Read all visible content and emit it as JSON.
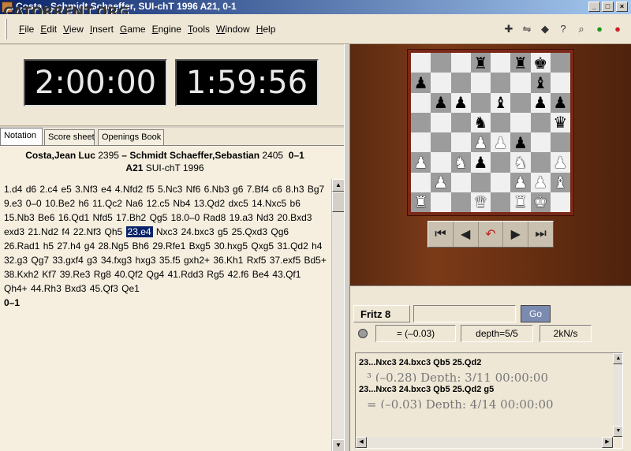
{
  "window": {
    "title": "Costa - Schmidt Schaeffer, SUI-chT 1996  A21, 0-1",
    "watermark": "CATORRENT.ORG",
    "buttons": {
      "minimize": "_",
      "maximize": "□",
      "close": "×"
    }
  },
  "menu": [
    "File",
    "Edit",
    "View",
    "Insert",
    "Game",
    "Engine",
    "Tools",
    "Window",
    "Help"
  ],
  "toolbar": [
    {
      "name": "new-game-icon",
      "glyph": "✚"
    },
    {
      "name": "flip-board-icon",
      "glyph": "⇋"
    },
    {
      "name": "hint-icon",
      "glyph": "◆"
    },
    {
      "name": "help-query-icon",
      "glyph": "?"
    },
    {
      "name": "analysis-icon",
      "glyph": "⌕"
    },
    {
      "name": "ok-icon",
      "glyph": "●"
    },
    {
      "name": "stop-icon",
      "glyph": "●"
    }
  ],
  "clocks": {
    "white": "2:00:00",
    "black": "1:59:56"
  },
  "tabs": {
    "notation": "Notation",
    "score_sheet": "Score sheet",
    "openings_book": "Openings Book"
  },
  "game": {
    "white": "Costa,Jean Luc",
    "white_elo": "2395",
    "separator": "–",
    "black": "Schmidt Schaeffer,Sebastian",
    "black_elo": "2405",
    "result": "0–1",
    "eco": "A21",
    "event": "SUI-chT 1996",
    "moves": [
      "1.d4",
      "d6",
      "2.c4",
      "e5",
      "3.Nf3",
      "e4",
      "4.Nfd2",
      "f5",
      "5.Nc3",
      "Nf6",
      "6.Nb3",
      "g6",
      "7.Bf4",
      "c6",
      "8.h3",
      "Bg7",
      "9.e3",
      "0–0",
      "10.Be2",
      "h6",
      "11.Qc2",
      "Na6",
      "12.c5",
      "Nb4",
      "13.Qd2",
      "dxc5",
      "14.Nxc5",
      "b6",
      "15.Nb3",
      "Be6",
      "16.Qd1",
      "Nfd5",
      "17.Bh2",
      "Qg5",
      "18.0–0",
      "Rad8",
      "19.a3",
      "Nd3",
      "20.Bxd3",
      "exd3",
      "21.Nd2",
      "f4",
      "22.Nf3",
      "Qh5",
      "23.e4",
      "Nxc3",
      "24.bxc3",
      "g5",
      "25.Qxd3",
      "Qg6",
      "26.Rad1",
      "h5",
      "27.h4",
      "g4",
      "28.Ng5",
      "Bh6",
      "29.Rfe1",
      "Bxg5",
      "30.hxg5",
      "Qxg5",
      "31.Qd2",
      "h4",
      "32.g3",
      "Qg7",
      "33.gxf4",
      "g3",
      "34.fxg3",
      "hxg3",
      "35.f5",
      "gxh2+",
      "36.Kh1",
      "Rxf5",
      "37.exf5",
      "Bd5+",
      "38.Kxh2",
      "Kf7",
      "39.Re3",
      "Rg8",
      "40.Qf2",
      "Qg4",
      "41.Rdd3",
      "Rg5",
      "42.f6",
      "Be4",
      "43.Qf1",
      "Qh4+",
      "44.Rh3",
      "Bxd3",
      "45.Qf3",
      "Qe1"
    ],
    "current_move": "23.e4",
    "final_result": "0–1"
  },
  "board": [
    [
      "",
      "",
      "",
      "bR",
      "",
      "bR",
      "bK",
      ""
    ],
    [
      "bP",
      "",
      "",
      "",
      "",
      "",
      "bB",
      ""
    ],
    [
      "",
      "bP",
      "bP",
      "",
      "bB",
      "",
      "bP",
      "bP"
    ],
    [
      "",
      "",
      "",
      "bN",
      "",
      "",
      "",
      "bQ"
    ],
    [
      "",
      "",
      "",
      "wP",
      "wP",
      "bP",
      "",
      ""
    ],
    [
      "wP",
      "",
      "wN",
      "bP",
      "",
      "wN",
      "",
      "wP"
    ],
    [
      "",
      "wP",
      "",
      "",
      "",
      "wP",
      "wP",
      "wB"
    ],
    [
      "wR",
      "",
      "",
      "wQ",
      "",
      "wR",
      "wK",
      ""
    ]
  ],
  "navigation": [
    {
      "name": "first-move-icon",
      "glyph": "⏮"
    },
    {
      "name": "prev-move-icon",
      "glyph": "◀"
    },
    {
      "name": "takeback-icon",
      "glyph": "↶"
    },
    {
      "name": "next-move-icon",
      "glyph": "▶"
    },
    {
      "name": "last-move-icon",
      "glyph": "⏭"
    }
  ],
  "engine": {
    "name": "Fritz 8",
    "input_value": "",
    "go_label": "Go",
    "eval": "= (–0.03)",
    "depth": "depth=5/5",
    "speed": "2kN/s",
    "lines": [
      {
        "moves": "23...Nxc3 24.bxc3 Qb5 25.Qd2",
        "info": "³  (–0.28)   Depth: 3/11   00:00:00"
      },
      {
        "moves": "23...Nxc3 24.bxc3 Qb5 25.Qd2 g5",
        "info": "=  (–0.03)   Depth: 4/14   00:00:00"
      }
    ]
  },
  "colors": {
    "title_start": "#0a246a",
    "title_end": "#a6caf0",
    "current_move_bg": "#0a246a",
    "go_button": "#7a8ab0"
  }
}
